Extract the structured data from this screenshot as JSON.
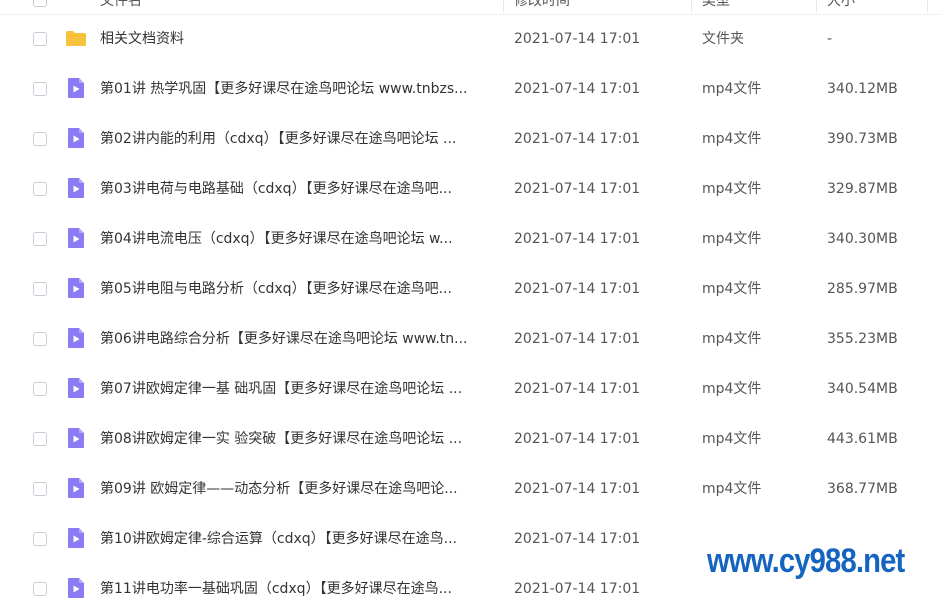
{
  "header": {
    "name_label": "文件名",
    "time_label": "修改时间",
    "type_label": "类型",
    "size_label": "大小"
  },
  "files": [
    {
      "name": "相关文档资料",
      "time": "2021-07-14 17:01",
      "type": "文件夹",
      "size": "-",
      "icon": "folder-icon"
    },
    {
      "name": "第01讲 热学巩固【更多好课尽在途鸟吧论坛 www.tnbzs...",
      "time": "2021-07-14 17:01",
      "type": "mp4文件",
      "size": "340.12MB",
      "icon": "video-file-icon"
    },
    {
      "name": "第02讲内能的利用（cdxq）【更多好课尽在途鸟吧论坛 ...",
      "time": "2021-07-14 17:01",
      "type": "mp4文件",
      "size": "390.73MB",
      "icon": "video-file-icon"
    },
    {
      "name": "第03讲电荷与电路基础（cdxq）【更多好课尽在途鸟吧...",
      "time": "2021-07-14 17:01",
      "type": "mp4文件",
      "size": "329.87MB",
      "icon": "video-file-icon"
    },
    {
      "name": "第04讲电流电压（cdxq）【更多好课尽在途鸟吧论坛 w...",
      "time": "2021-07-14 17:01",
      "type": "mp4文件",
      "size": "340.30MB",
      "icon": "video-file-icon"
    },
    {
      "name": "第05讲电阻与电路分析（cdxq）【更多好课尽在途鸟吧...",
      "time": "2021-07-14 17:01",
      "type": "mp4文件",
      "size": "285.97MB",
      "icon": "video-file-icon"
    },
    {
      "name": "第06讲电路综合分析【更多好课尽在途鸟吧论坛 www.tn...",
      "time": "2021-07-14 17:01",
      "type": "mp4文件",
      "size": "355.23MB",
      "icon": "video-file-icon"
    },
    {
      "name": "第07讲欧姆定律一基 础巩固【更多好课尽在途鸟吧论坛 ...",
      "time": "2021-07-14 17:01",
      "type": "mp4文件",
      "size": "340.54MB",
      "icon": "video-file-icon"
    },
    {
      "name": "第08讲欧姆定律一实 验突破【更多好课尽在途鸟吧论坛 ...",
      "time": "2021-07-14 17:01",
      "type": "mp4文件",
      "size": "443.61MB",
      "icon": "video-file-icon"
    },
    {
      "name": "第09讲 欧姆定律——动态分析【更多好课尽在途鸟吧论...",
      "time": "2021-07-14 17:01",
      "type": "mp4文件",
      "size": "368.77MB",
      "icon": "video-file-icon"
    },
    {
      "name": "第10讲欧姆定律-综合运算（cdxq）【更多好课尽在途鸟...",
      "time": "2021-07-14 17:01",
      "type": "",
      "size": "",
      "icon": "video-file-icon"
    },
    {
      "name": "第11讲电功率一基础巩固（cdxq）【更多好课尽在途鸟...",
      "time": "2021-07-14 17:01",
      "type": "",
      "size": "",
      "icon": "video-file-icon"
    }
  ],
  "watermark": "www.cy988.net",
  "colors": {
    "folder": "#f7c23c",
    "video_icon": "#8b7cf6",
    "watermark": "#1565c0"
  }
}
